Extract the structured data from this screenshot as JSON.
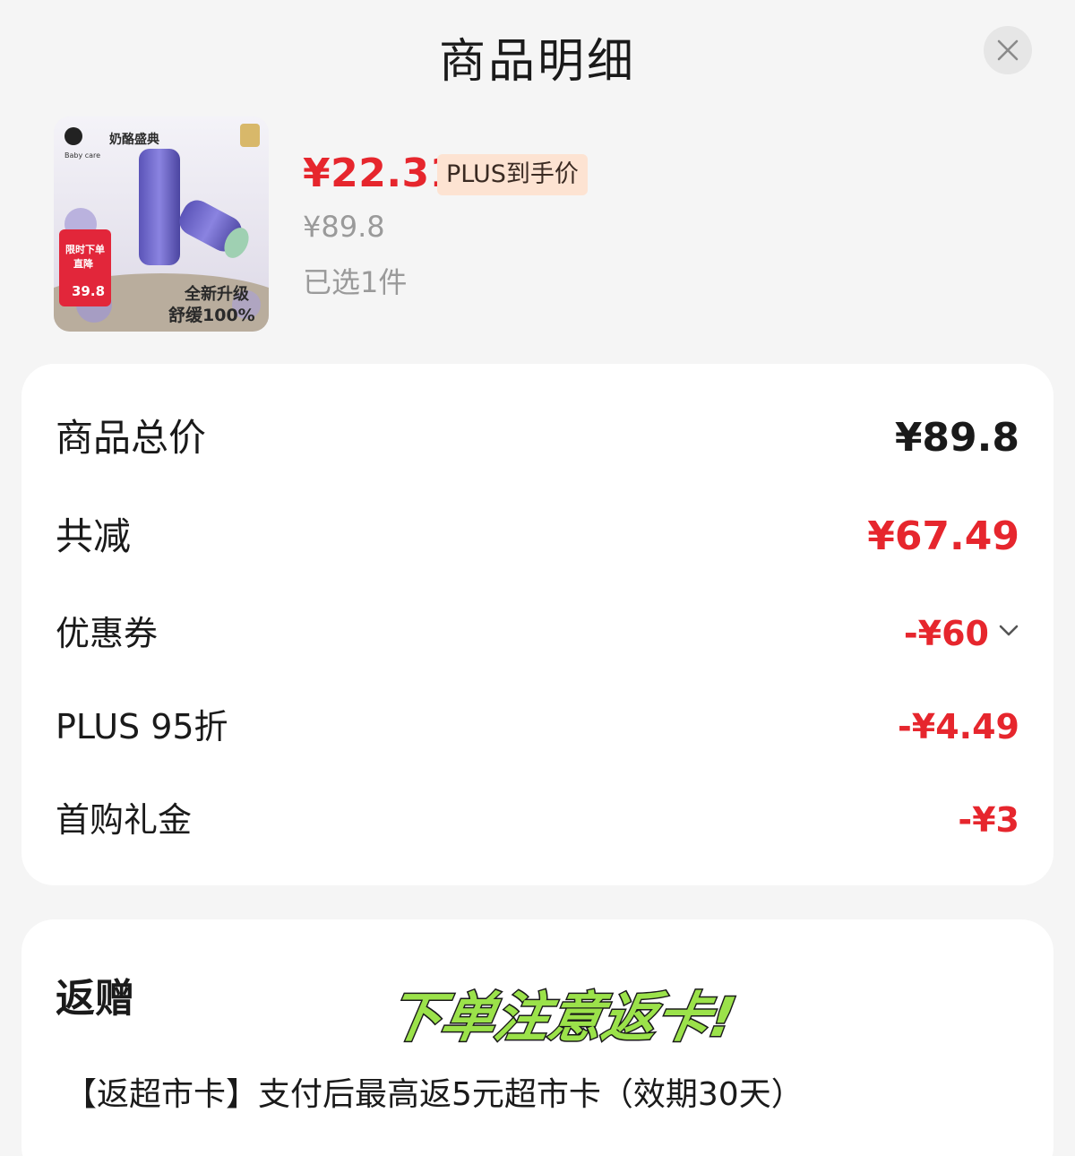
{
  "header": {
    "title": "商品明细",
    "close_icon": "close-icon"
  },
  "product": {
    "image_alt": "Babycare 舒缓膏产品图",
    "image_text": {
      "brand": "Baby care",
      "banner": "奶酪盛典",
      "promo_line1": "限时下单",
      "promo_line2": "直降",
      "promo_price": "39.8",
      "headline1": "全新升级",
      "headline2": "舒缓100%"
    },
    "price": "¥22.31",
    "price_tag": "PLUS到手价",
    "original_price": "¥89.8",
    "selected_count": "已选1件"
  },
  "summary": {
    "total_label": "商品总价",
    "total_value": "¥89.8",
    "reduce_label": "共减",
    "reduce_value": "¥67.49",
    "items": [
      {
        "label": "优惠券",
        "value": "-¥60",
        "expandable": true
      },
      {
        "label": "PLUS 95折",
        "value": "-¥4.49"
      },
      {
        "label": "首购礼金",
        "value": "-¥3"
      }
    ]
  },
  "gift": {
    "title": "返赠",
    "sticker_text": "下单注意返卡!",
    "description": "【返超市卡】支付后最高返5元超市卡（效期30天）"
  },
  "colors": {
    "accent_red": "#e6262d",
    "plus_tag_bg": "#fde3d2",
    "sticker_green": "#9be24a"
  }
}
